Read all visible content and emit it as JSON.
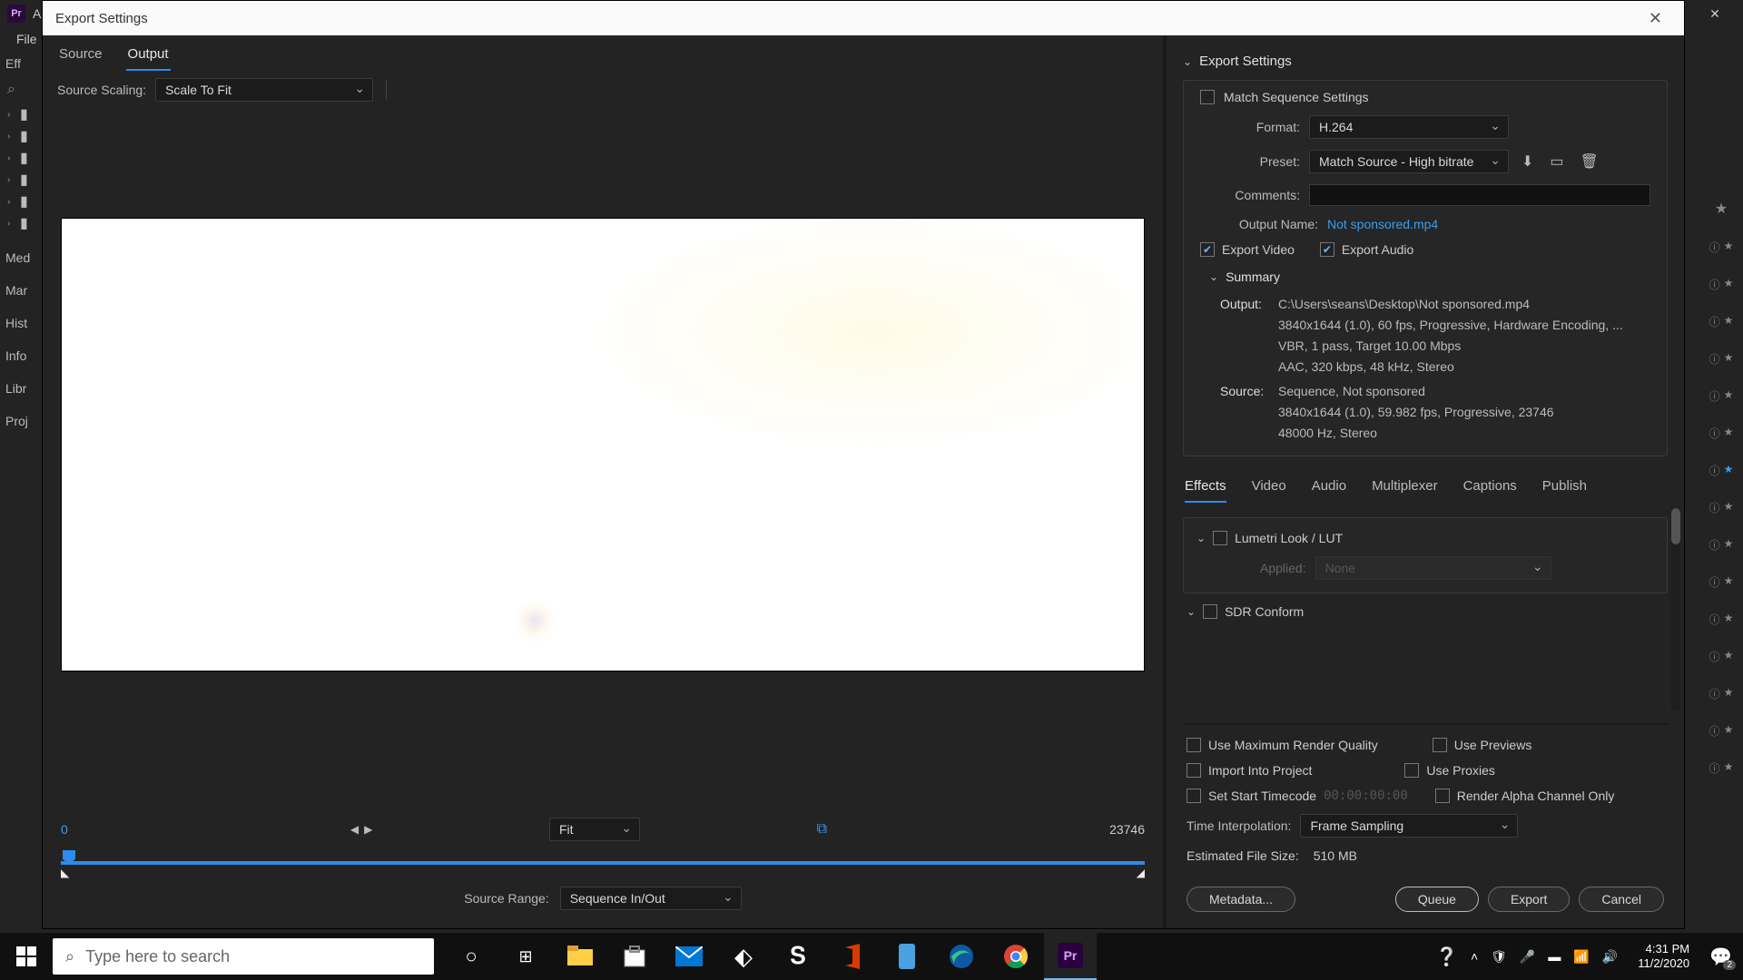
{
  "bg_app": {
    "title_prefix": "Ad",
    "menu": [
      "File"
    ],
    "panels": [
      "Med",
      "Mar",
      "Hist",
      "Info",
      "Libr",
      "Proj"
    ]
  },
  "dialog": {
    "title": "Export Settings",
    "tabs": [
      "Source",
      "Output"
    ],
    "source_scaling_label": "Source Scaling:",
    "source_scaling_value": "Scale To Fit",
    "timeline": {
      "start": "0",
      "end": "23746"
    },
    "fit_label": "Fit",
    "source_range_label": "Source Range:",
    "source_range_value": "Sequence In/Out"
  },
  "settings": {
    "header": "Export Settings",
    "match_seq": "Match Sequence Settings",
    "format_label": "Format:",
    "format_value": "H.264",
    "preset_label": "Preset:",
    "preset_value": "Match Source - High bitrate",
    "comments_label": "Comments:",
    "output_name_label": "Output Name:",
    "output_name_value": "Not sponsored.mp4",
    "export_video": "Export Video",
    "export_audio": "Export Audio",
    "summary_label": "Summary",
    "summary": {
      "output_label": "Output:",
      "output_path": "C:\\Users\\seans\\Desktop\\Not sponsored.mp4",
      "output_l2": "3840x1644 (1.0), 60 fps, Progressive, Hardware Encoding, ...",
      "output_l3": "VBR, 1 pass, Target 10.00 Mbps",
      "output_l4": "AAC, 320 kbps, 48 kHz, Stereo",
      "source_label": "Source:",
      "source_l1": "Sequence, Not sponsored",
      "source_l2": "3840x1644 (1.0), 59.982 fps, Progressive, 23746",
      "source_l3": "48000 Hz, Stereo"
    }
  },
  "bottom_tabs": [
    "Effects",
    "Video",
    "Audio",
    "Multiplexer",
    "Captions",
    "Publish"
  ],
  "effects": {
    "lumetri": "Lumetri Look / LUT",
    "applied_label": "Applied:",
    "applied_value": "None",
    "sdr": "SDR Conform"
  },
  "render": {
    "max_quality": "Use Maximum Render Quality",
    "previews": "Use Previews",
    "import": "Import Into Project",
    "proxies": "Use Proxies",
    "start_tc": "Set Start Timecode",
    "tc_val": "00:00:00:00",
    "alpha": "Render Alpha Channel Only",
    "time_interp_label": "Time Interpolation:",
    "time_interp_value": "Frame Sampling",
    "est_label": "Estimated File Size:",
    "est_value": "510 MB"
  },
  "buttons": {
    "metadata": "Metadata...",
    "queue": "Queue",
    "export": "Export",
    "cancel": "Cancel"
  },
  "taskbar": {
    "search_placeholder": "Type here to search",
    "time": "4:31 PM",
    "date": "11/2/2020",
    "notif_count": "2"
  }
}
